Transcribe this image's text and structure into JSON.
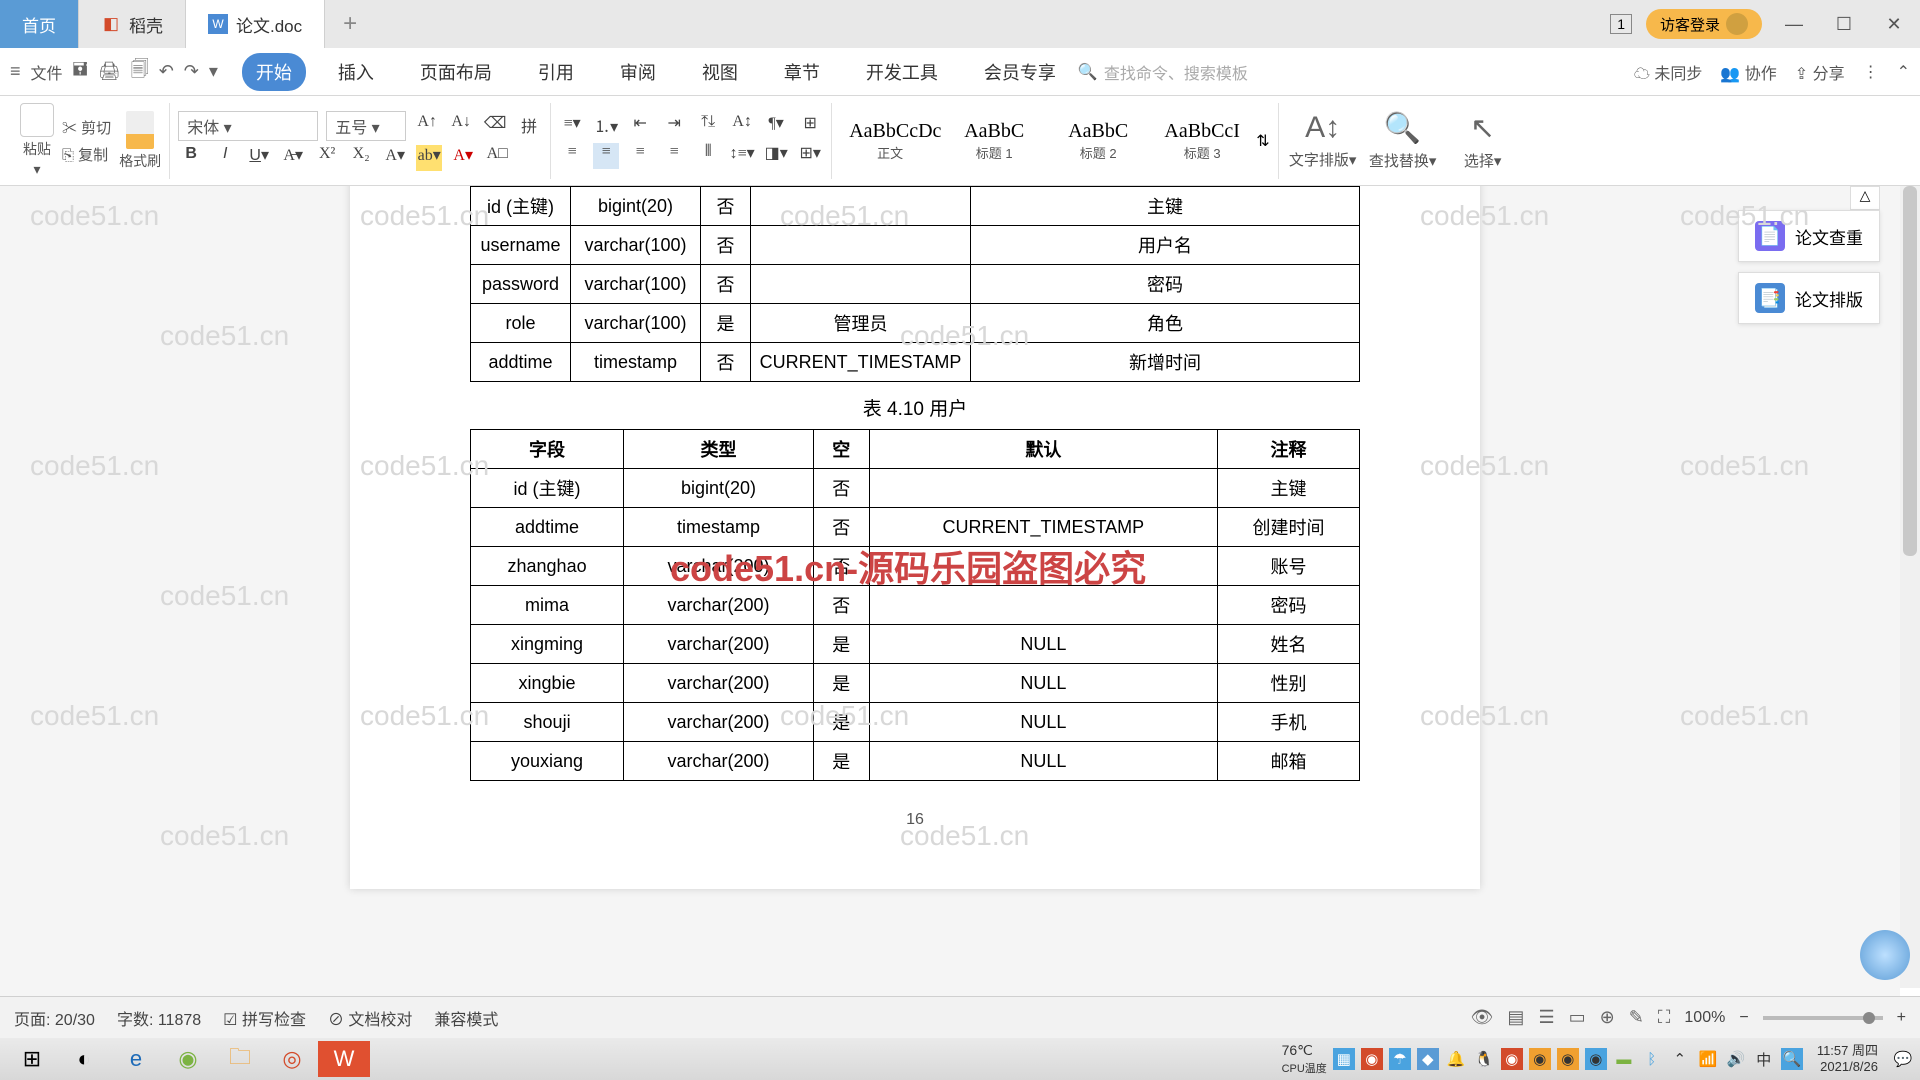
{
  "tabs": {
    "home": "首页",
    "t1": "稻壳",
    "t2": "论文.doc"
  },
  "titlebar": {
    "login": "访客登录",
    "one": "1"
  },
  "menu": {
    "file": "文件",
    "start": "开始",
    "insert": "插入",
    "layout": "页面布局",
    "ref": "引用",
    "review": "审阅",
    "view": "视图",
    "chapter": "章节",
    "dev": "开发工具",
    "vip": "会员专享",
    "search_ph": "查找命令、搜索模板",
    "unsync": "未同步",
    "collab": "协作",
    "share": "分享"
  },
  "toolbar": {
    "paste": "粘贴",
    "cut": "剪切",
    "copy": "复制",
    "brush": "格式刷",
    "font": "宋体",
    "size": "五号",
    "styles": [
      {
        "p": "AaBbCcDc",
        "n": "正文"
      },
      {
        "p": "AaBbC",
        "n": "标题 1"
      },
      {
        "p": "AaBbC",
        "n": "标题 2"
      },
      {
        "p": "AaBbCcI",
        "n": "标题 3"
      }
    ],
    "textdir": "文字排版",
    "find": "查找替换",
    "select": "选择"
  },
  "doc": {
    "t1_rows": [
      [
        "id (主键)",
        "bigint(20)",
        "否",
        "",
        "主键"
      ],
      [
        "username",
        "varchar(100)",
        "否",
        "",
        "用户名"
      ],
      [
        "password",
        "varchar(100)",
        "否",
        "",
        "密码"
      ],
      [
        "role",
        "varchar(100)",
        "是",
        "管理员",
        "角色"
      ],
      [
        "addtime",
        "timestamp",
        "否",
        "CURRENT_TIMESTAMP",
        "新增时间"
      ]
    ],
    "caption": "表 4.10  用户",
    "t2_header": [
      "字段",
      "类型",
      "空",
      "默认",
      "注释"
    ],
    "t2_rows": [
      [
        "id (主键)",
        "bigint(20)",
        "否",
        "",
        "主键"
      ],
      [
        "addtime",
        "timestamp",
        "否",
        "CURRENT_TIMESTAMP",
        "创建时间"
      ],
      [
        "zhanghao",
        "varchar(200)",
        "否",
        "",
        "账号"
      ],
      [
        "mima",
        "varchar(200)",
        "否",
        "",
        "密码"
      ],
      [
        "xingming",
        "varchar(200)",
        "是",
        "NULL",
        "姓名"
      ],
      [
        "xingbie",
        "varchar(200)",
        "是",
        "NULL",
        "性别"
      ],
      [
        "shouji",
        "varchar(200)",
        "是",
        "NULL",
        "手机"
      ],
      [
        "youxiang",
        "varchar(200)",
        "是",
        "NULL",
        "邮箱"
      ]
    ],
    "page_num": "16"
  },
  "side": {
    "check": "论文查重",
    "format": "论文排版"
  },
  "status": {
    "page": "页面: 20/30",
    "words": "字数: 11878",
    "spell": "拼写检查",
    "proof": "文档校对",
    "compat": "兼容模式",
    "zoom": "100%"
  },
  "tray": {
    "temp_label": "CPU温度",
    "temp": "76℃",
    "time": "11:57 周四",
    "date": "2021/8/26"
  },
  "watermark": {
    "main": "code51.cn-源码乐园盗图必究",
    "bg": "code51.cn"
  }
}
